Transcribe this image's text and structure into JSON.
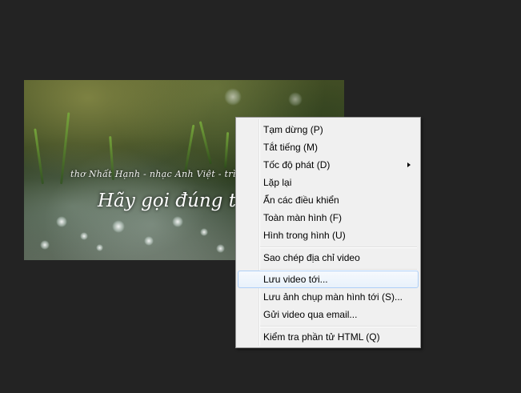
{
  "video": {
    "subtitle_line1": "thơ Nhất Hạnh - nhạc Anh Việt - trìn",
    "subtitle_line2": "Hãy gọi đúng tê"
  },
  "context_menu": {
    "items": [
      {
        "label": "Tạm dừng (P)",
        "has_submenu": false
      },
      {
        "label": "Tắt tiếng (M)",
        "has_submenu": false
      },
      {
        "label": "Tốc độ phát (D)",
        "has_submenu": true
      },
      {
        "label": "Lặp lại",
        "has_submenu": false
      },
      {
        "label": "Ẩn các điều khiển",
        "has_submenu": false
      },
      {
        "label": "Toàn màn hình (F)",
        "has_submenu": false
      },
      {
        "label": "Hình trong hình (U)",
        "has_submenu": false
      },
      {
        "label": "Sao chép địa chỉ video",
        "has_submenu": false
      },
      {
        "label": "Lưu video tới...",
        "has_submenu": false,
        "highlighted": true
      },
      {
        "label": "Lưu ảnh chụp màn hình tới (S)...",
        "has_submenu": false
      },
      {
        "label": "Gửi video qua email...",
        "has_submenu": false
      },
      {
        "label": "Kiểm tra phần tử HTML (Q)",
        "has_submenu": false
      }
    ]
  },
  "colors": {
    "page_background": "#232323",
    "menu_background": "#f0f0f0",
    "highlight_border": "#aecff7"
  }
}
